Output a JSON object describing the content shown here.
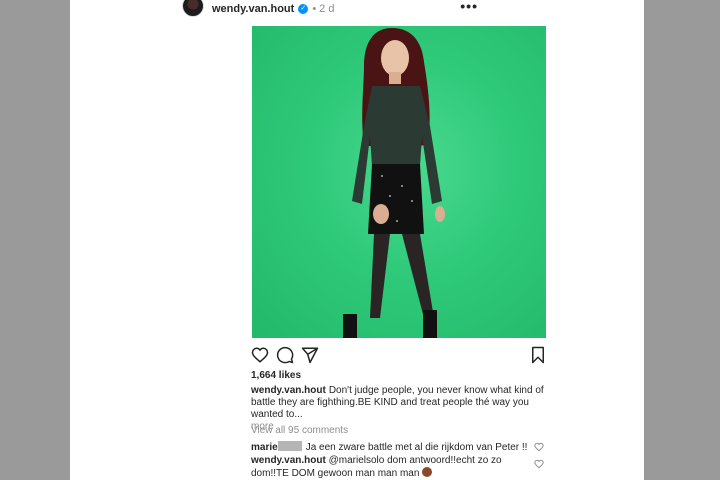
{
  "post": {
    "username": "wendy.van.hout",
    "verified_icon": "check",
    "separator": "•",
    "time": "2 d",
    "more_icon": "•••"
  },
  "photo": {
    "description_icon": "photo",
    "background": "#2fc97a"
  },
  "actions": {
    "like_icon": "heart-outline",
    "comment_icon": "comment-bubble",
    "share_icon": "paper-plane",
    "save_icon": "bookmark"
  },
  "likes": "1,664 likes",
  "caption": {
    "user": "wendy.van.hout",
    "text": "Don't judge people, you never know what kind of battle they are fighthing.BE KIND and treat people thé way you wanted to...",
    "more": "more"
  },
  "view_all": "View all 95 comments",
  "comments": [
    {
      "user": "marie",
      "text": "Ja een zware battle met al die rijkdom van Peter !!"
    },
    {
      "user": "wendy.van.hout",
      "text": "@marielsolo dom antwoord!!echt zo zo dom!!TE DOM gewoon man man man"
    }
  ]
}
